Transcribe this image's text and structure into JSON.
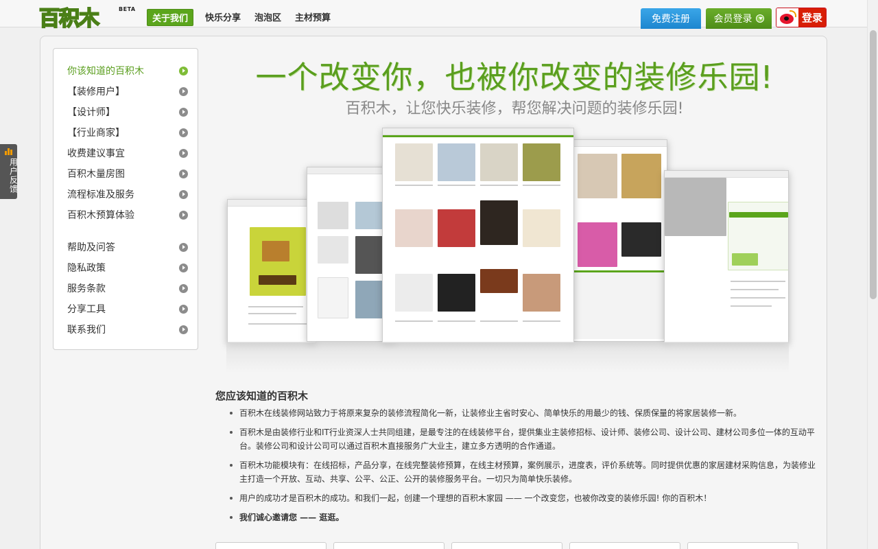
{
  "header": {
    "logo_text": "百积木",
    "logo_badge": "BETA",
    "nav": [
      {
        "label": "关于我们",
        "active": true
      },
      {
        "label": "快乐分享",
        "active": false
      },
      {
        "label": "泡泡区",
        "active": false
      },
      {
        "label": "主材预算",
        "active": false
      }
    ],
    "register_label": "免费注册",
    "member_login_label": "会员登录",
    "weibo_login_label": "登录"
  },
  "feedback": {
    "label": "用户反馈"
  },
  "sidebar": {
    "items": [
      {
        "label": "你该知道的百积木",
        "active": true
      },
      {
        "label": "【装修用户】",
        "active": false
      },
      {
        "label": "【设计师】",
        "active": false
      },
      {
        "label": "【行业商家】",
        "active": false
      },
      {
        "label": "收费建议事宜",
        "active": false
      },
      {
        "label": "百积木量房图",
        "active": false
      },
      {
        "label": "流程标准及服务",
        "active": false
      },
      {
        "label": "百积木预算体验",
        "active": false
      },
      {
        "label": "帮助及问答",
        "active": false
      },
      {
        "label": "隐私政策",
        "active": false
      },
      {
        "label": "服务条款",
        "active": false
      },
      {
        "label": "分享工具",
        "active": false
      },
      {
        "label": "联系我们",
        "active": false
      }
    ]
  },
  "hero": {
    "title": "一个改变你，也被你改变的装修乐园!",
    "subtitle": "百积木，让您快乐装修，帮您解决问题的装修乐园!"
  },
  "about": {
    "title": "您应该知道的百积木",
    "paragraphs": [
      "百积木在线装修网站致力于将原来复杂的装修流程简化一新，让装修业主省时安心、简单快乐的用最少的钱、保质保量的将家居装修一新。",
      "百积木是由装修行业和IT行业资深人士共同组建，是最专注的在线装修平台，提供集业主装修招标、设计师、装修公司、设计公司、建材公司多位一体的互动平台。装修公司和设计公司可以通过百积木直接服务广大业主，建立多方透明的合作通道。",
      "百积木功能模块有：在线招标，产品分享，在线完整装修预算，在线主材预算，案例展示，进度表，评价系统等。同时提供优惠的家居建材采购信息，为装修业主打造一个开放、互动、共享、公平、公正、公开的装修服务平台。一切只为简单快乐装修。",
      "用户的成功才是百积木的成功。和我们一起，创建一个理想的百积木家园 —— 一个改变您，也被你改变的装修乐园! 你的百积木！",
      "我们诚心邀请您 —— 逛逛。"
    ]
  },
  "colors": {
    "brand_green": "#5a9e1e",
    "register_blue": "#1d86cf",
    "weibo_red": "#d81e06"
  }
}
